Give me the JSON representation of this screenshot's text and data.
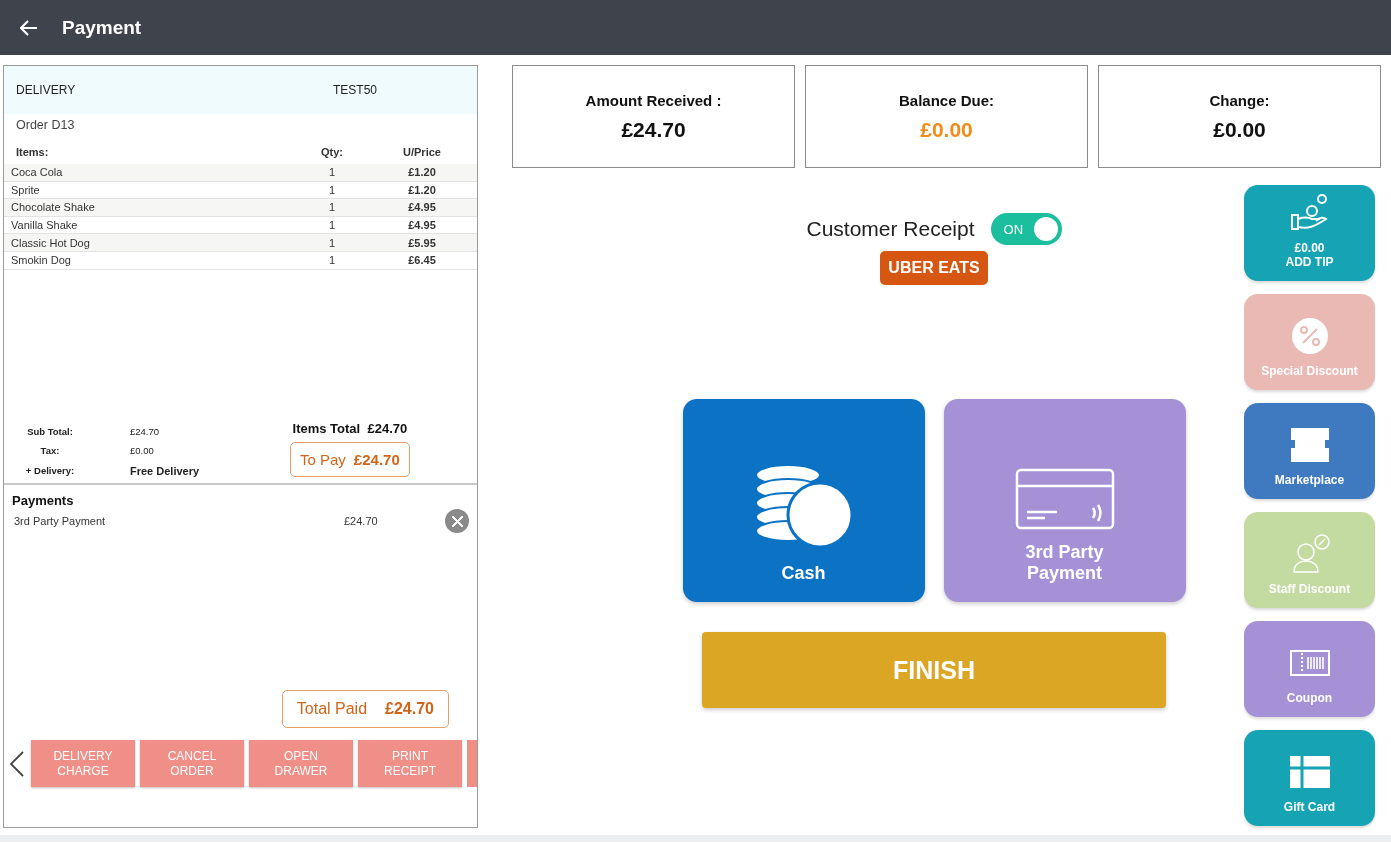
{
  "header": {
    "title": "Payment"
  },
  "order": {
    "type": "DELIVERY",
    "code": "TEST50",
    "number": "Order D13",
    "columns": [
      "Items:",
      "Qty:",
      "U/Price"
    ],
    "items": [
      {
        "name": "Coca Cola",
        "qty": "1",
        "price": "£1.20"
      },
      {
        "name": "Sprite",
        "qty": "1",
        "price": "£1.20"
      },
      {
        "name": "Chocolate Shake",
        "qty": "1",
        "price": "£4.95"
      },
      {
        "name": "Vanilla Shake",
        "qty": "1",
        "price": "£4.95"
      },
      {
        "name": "Classic Hot Dog",
        "qty": "1",
        "price": "£5.95"
      },
      {
        "name": "Smokin Dog",
        "qty": "1",
        "price": "£6.45"
      }
    ],
    "totals": [
      {
        "label": "Sub Total:",
        "value": "£24.70",
        "kind": "plain"
      },
      {
        "label": "Tax:",
        "value": "£0.00",
        "kind": "plain"
      },
      {
        "label": "+ Delivery:",
        "value": "Free Delivery",
        "kind": "bold"
      }
    ],
    "items_total": {
      "label": "Items Total",
      "value": "£24.70"
    },
    "to_pay": {
      "label": "To Pay",
      "value": "£24.70"
    },
    "payments_title": "Payments",
    "payments": [
      {
        "name": "3rd Party Payment",
        "amount": "£24.70"
      }
    ],
    "total_paid": {
      "label": "Total Paid",
      "value": "£24.70"
    },
    "actions": [
      {
        "label": "DELIVERY CHARGE"
      },
      {
        "label": "CANCEL ORDER"
      },
      {
        "label": "OPEN DRAWER"
      },
      {
        "label": "PRINT RECEIPT"
      }
    ]
  },
  "summary": [
    {
      "label": "Amount Received :",
      "value": "£24.70",
      "color": "#111111"
    },
    {
      "label": "Balance Due:",
      "value": "£0.00",
      "color": "#f08c1a"
    },
    {
      "label": "Change:",
      "value": "£0.00",
      "color": "#111111"
    }
  ],
  "customer_receipt": {
    "label": "Customer Receipt",
    "toggle_text": "ON",
    "on": true
  },
  "provider_badge": "UBER EATS",
  "methods": [
    {
      "kind": "cash",
      "label": "Cash",
      "color": "#0b72c4"
    },
    {
      "kind": "card",
      "label": "3rd Party Payment",
      "color": "#a592d6"
    }
  ],
  "finish": "FINISH",
  "side_buttons": [
    {
      "kind": "tip",
      "value": "£0.00",
      "label": "ADD TIP",
      "color": "#16a3b4"
    },
    {
      "kind": "special",
      "label": "Special Discount",
      "color": "#eab9b4"
    },
    {
      "kind": "market",
      "label": "Marketplace",
      "color": "#3f7ac0"
    },
    {
      "kind": "staff",
      "label": "Staff Discount",
      "color": "#c3dba0"
    },
    {
      "kind": "coupon",
      "label": "Coupon",
      "color": "#a592d6"
    },
    {
      "kind": "gift",
      "label": "Gift Card",
      "color": "#16a3b4"
    }
  ]
}
